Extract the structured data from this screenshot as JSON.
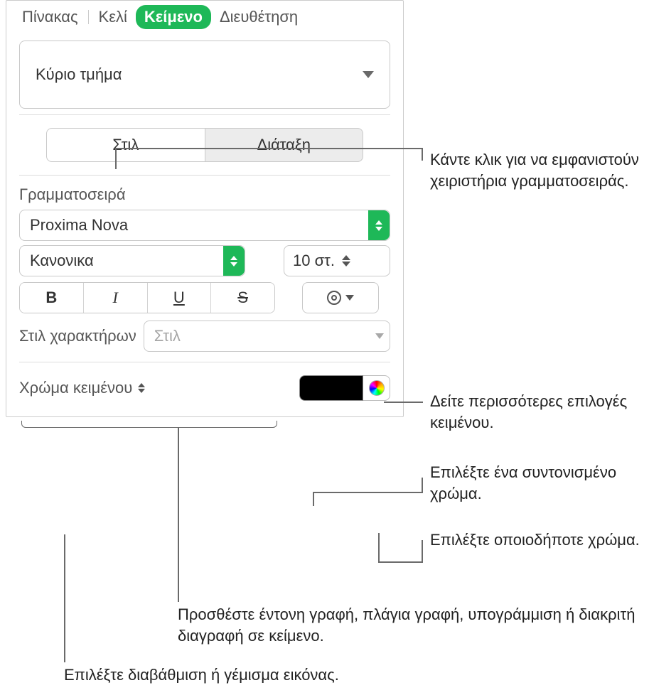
{
  "top_tabs": {
    "table": "Πίνακας",
    "cell": "Κελί",
    "text": "Κείμενο",
    "arrange": "Διευθέτηση"
  },
  "section_select": "Κύριο τμήμα",
  "subtabs": {
    "style": "Στιλ",
    "layout": "Διάταξη"
  },
  "font": {
    "heading": "Γραμματοσειρά",
    "family": "Proxima Nova",
    "weight": "Κανονικα",
    "size": "10 στ.",
    "bold": "B",
    "italic": "I",
    "underline": "U",
    "strike": "S"
  },
  "char_style": {
    "label": "Στιλ χαρακτήρων",
    "placeholder": "Στιλ"
  },
  "text_color": {
    "label": "Χρώμα κειμένου",
    "swatch": "#000000"
  },
  "callouts": {
    "c1": "Κάντε κλικ για να εμφανιστούν χειριστήρια γραμματοσειράς.",
    "c2": "Δείτε περισσότερες επιλογές κειμένου.",
    "c3": "Επιλέξτε ένα συντονισμένο χρώμα.",
    "c4": "Επιλέξτε οποιοδήποτε χρώμα.",
    "c5": "Προσθέστε έντονη γραφή, πλάγια γραφή, υπογράμμιση ή διακριτή διαγραφή σε κείμενο.",
    "c6": "Επιλέξτε διαβάθμιση ή γέμισμα εικόνας."
  }
}
